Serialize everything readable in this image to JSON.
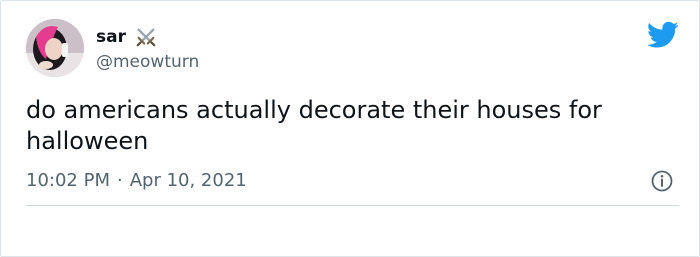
{
  "tweet": {
    "author": {
      "display_name": "sar",
      "handle": "@meowturn",
      "name_emoji_icon": "crossed-swords-icon",
      "avatar_icon": "profile-avatar"
    },
    "text": "do americans actually decorate their houses for halloween",
    "time": "10:02 PM",
    "separator": "·",
    "date": "Apr 10, 2021",
    "brand_icon": "twitter-bird-icon",
    "info_icon": "info-icon"
  },
  "colors": {
    "text_primary": "#0f1419",
    "text_secondary": "#536471",
    "twitter_blue": "#1d9bf0",
    "divider": "#cfd9de"
  }
}
